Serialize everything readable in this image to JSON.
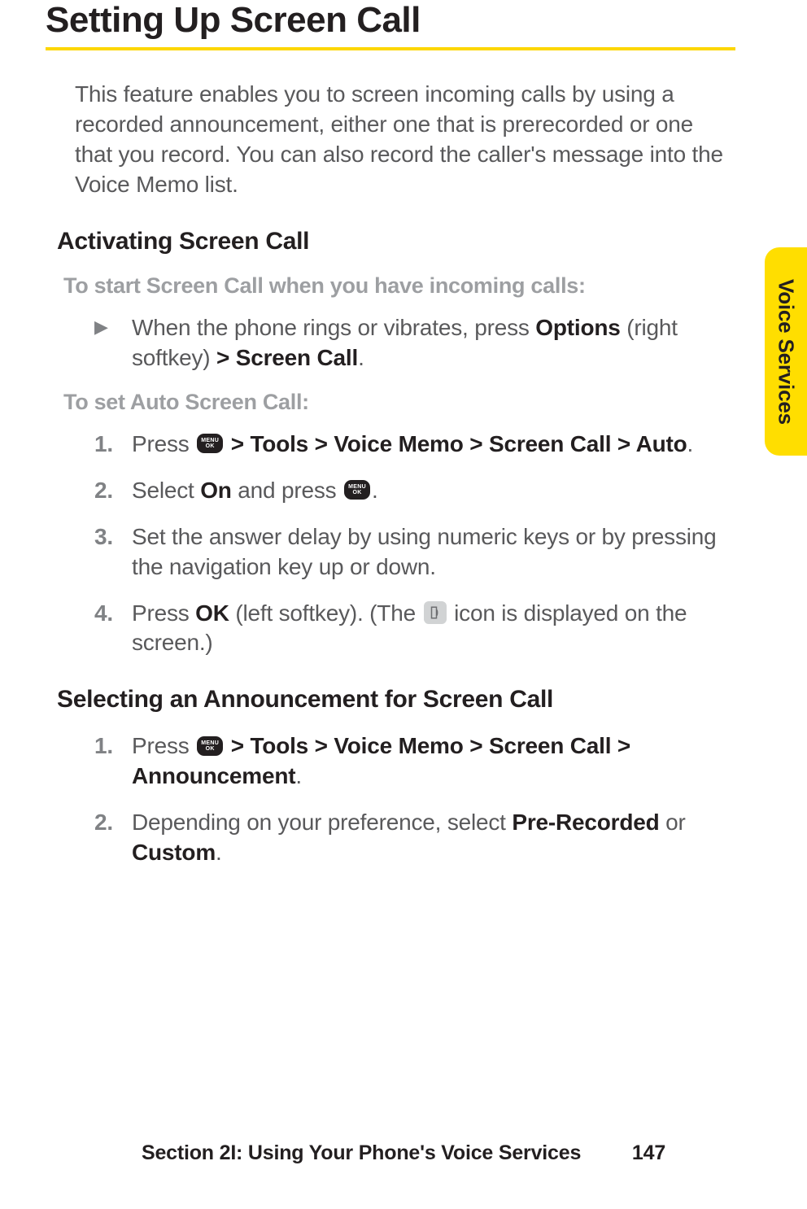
{
  "title": "Setting Up Screen Call",
  "intro": "This feature enables you to screen incoming calls by using a recorded announcement, either one that is prerecorded or one that you record. You can also record the caller's message into the Voice Memo list.",
  "section1": {
    "heading": "Activating Screen Call",
    "gray1": "To start Screen Call when you have incoming calls:",
    "bullet": {
      "marker": "▶",
      "pre": "When the phone rings or vibrates, press ",
      "bold1": "Options",
      "mid": " (right softkey) ",
      "bold2": "> Screen Call",
      "post": "."
    },
    "gray2": "To set Auto Screen Call:",
    "steps": [
      {
        "num": "1.",
        "pre": "Press ",
        "menu": true,
        "bold": " > Tools > Voice Memo > Screen Call > Auto",
        "post": "."
      },
      {
        "num": "2.",
        "pre": "Select ",
        "bold1": "On",
        "mid": " and press ",
        "menu": true,
        "post": "."
      },
      {
        "num": "3.",
        "text": "Set the answer delay by using numeric keys or by pressing the navigation key up or down."
      },
      {
        "num": "4.",
        "pre": "Press ",
        "bold1": "OK",
        "mid": " (left softkey). (The ",
        "icon": true,
        "post": " icon is displayed on the screen.)"
      }
    ]
  },
  "section2": {
    "heading": "Selecting an Announcement for Screen Call",
    "steps": [
      {
        "num": "1.",
        "pre": "Press ",
        "menu": true,
        "bold": " > Tools > Voice Memo > Screen Call > Announcement",
        "post": "."
      },
      {
        "num": "2.",
        "pre": "Depending on your preference, select ",
        "bold1": "Pre-Recorded",
        "mid": " or ",
        "bold2": "Custom",
        "post": "."
      }
    ]
  },
  "tab": "Voice Services",
  "footer": {
    "section": "Section 2I: Using Your Phone's Voice Services",
    "page": "147"
  },
  "menu_key_label": "MENU\nOK"
}
